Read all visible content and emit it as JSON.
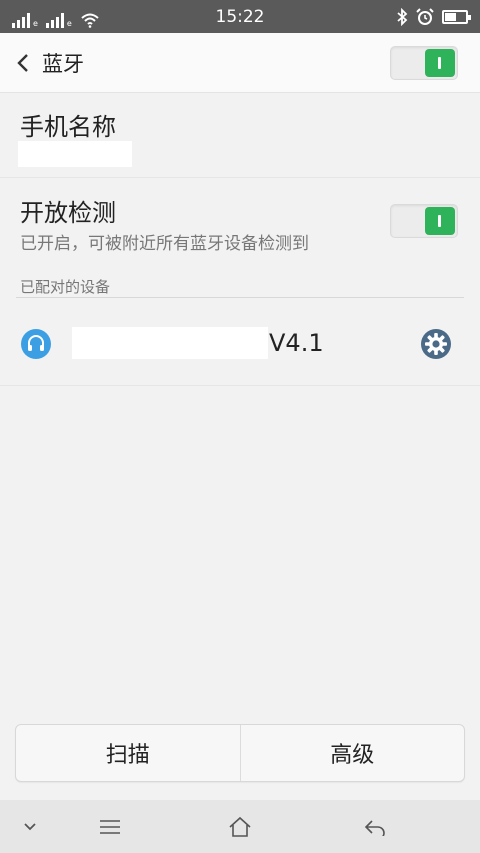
{
  "status_bar": {
    "time": "15:22",
    "network_label": "e",
    "icons": [
      "signal-icon",
      "signal-icon-2",
      "wifi-icon",
      "bluetooth-icon",
      "alarm-icon",
      "battery-icon"
    ]
  },
  "header": {
    "title": "蓝牙",
    "bluetooth_toggle": {
      "on": true
    }
  },
  "device_name_row": {
    "title": "手机名称",
    "value": ""
  },
  "detect_row": {
    "title": "开放检测",
    "subtitle": "已开启，可被附近所有蓝牙设备检测到",
    "toggle": {
      "on": true
    }
  },
  "paired_section": {
    "header": "已配对的设备",
    "devices": [
      {
        "name": "V4.1",
        "icon": "headset-icon",
        "settings_icon": "gear-icon"
      }
    ]
  },
  "actions": {
    "scan_label": "扫描",
    "advanced_label": "高级"
  },
  "nav_bar": {
    "icons": [
      "chevron-down-icon",
      "menu-icon",
      "home-icon",
      "back-icon"
    ]
  },
  "colors": {
    "status_bar": "#5a5a5a",
    "toggle_on": "#2fb35a",
    "headset_accent": "#3d9fe3",
    "gear": "#4a6a88"
  }
}
